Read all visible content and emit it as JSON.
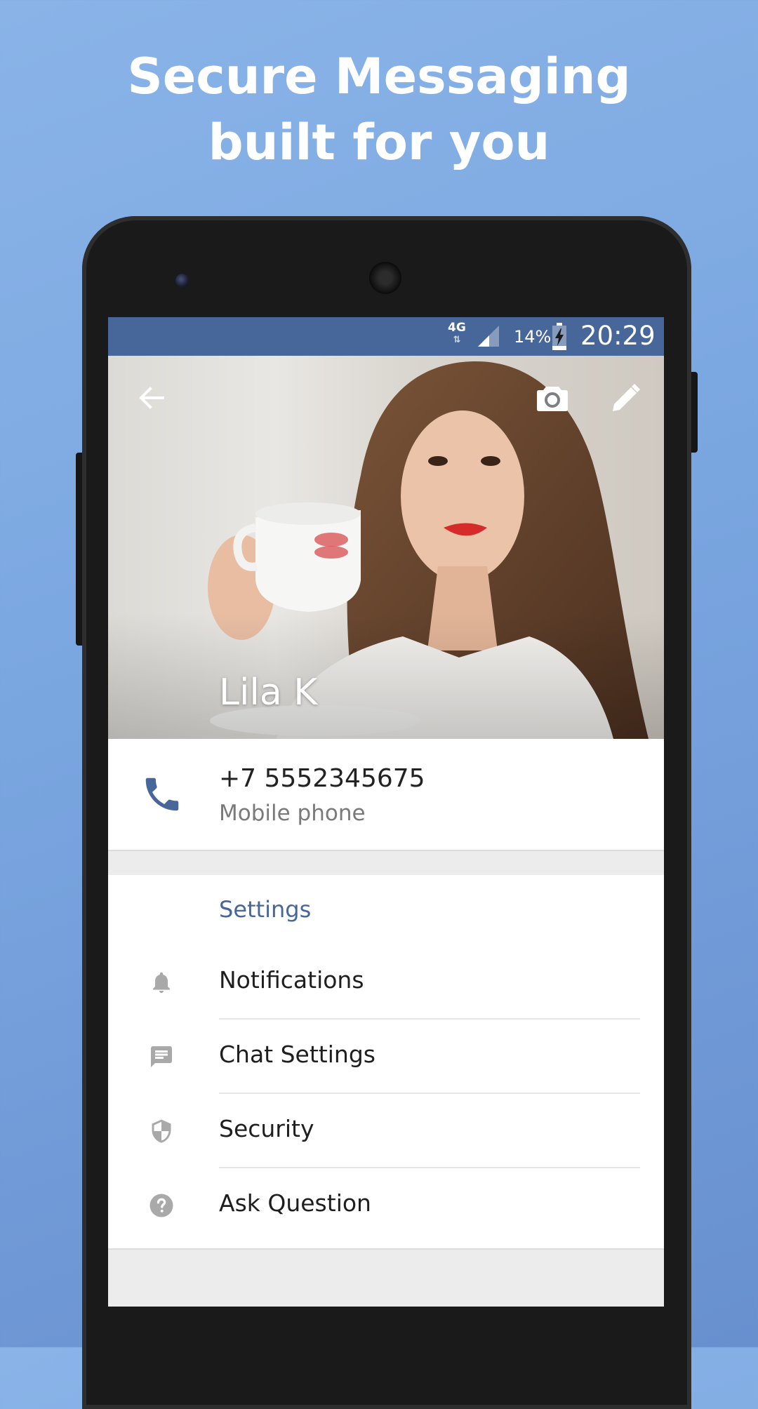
{
  "headline": {
    "line1": "Secure Messaging",
    "line2": "built for you"
  },
  "status_bar": {
    "network": "4G",
    "battery_percent": "14%",
    "time": "20:29"
  },
  "profile": {
    "name": "Lila K",
    "phone_number": "+7 5552345675",
    "phone_type": "Mobile phone"
  },
  "settings": {
    "title": "Settings",
    "items": [
      {
        "label": "Notifications",
        "icon": "bell-icon"
      },
      {
        "label": "Chat Settings",
        "icon": "chat-icon"
      },
      {
        "label": "Security",
        "icon": "shield-icon"
      },
      {
        "label": "Ask Question",
        "icon": "help-icon"
      }
    ]
  },
  "colors": {
    "accent": "#47679a",
    "status_bar": "#47679a",
    "background": "#7aa6e0"
  }
}
